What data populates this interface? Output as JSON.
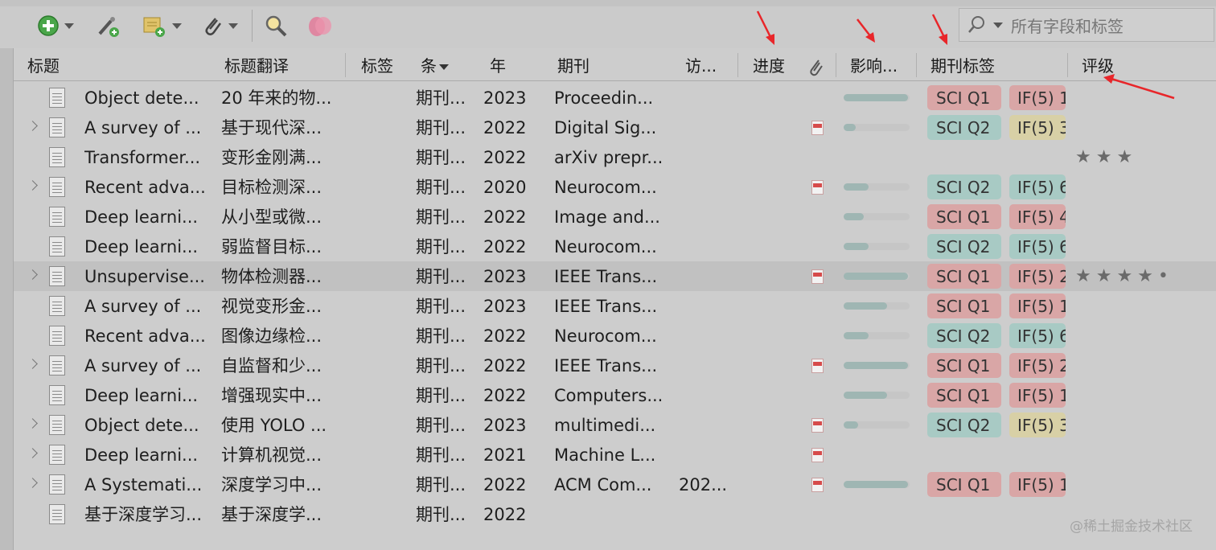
{
  "toolbar": {
    "search_placeholder": "所有字段和标签"
  },
  "columns": {
    "title": "标题",
    "title_translation": "标题翻译",
    "tags": "标签",
    "item_type": "条",
    "year": "年",
    "journal": "期刊",
    "access": "访...",
    "progress": "进度",
    "impact": "影响...",
    "journal_tags": "期刊标签",
    "rating": "评级"
  },
  "rows": [
    {
      "title": "Object dete...",
      "trans": "20 年来的物...",
      "type": "期刊...",
      "year": "2023",
      "journal": "Proceedin...",
      "access": "",
      "expand": false,
      "pdf": false,
      "impact": 0.98,
      "sci": "SCI Q1",
      "if": "IF(5) 1",
      "rating": ""
    },
    {
      "title": "A survey of ...",
      "trans": "基于现代深...",
      "type": "期刊...",
      "year": "2022",
      "journal": "Digital Sig...",
      "access": "",
      "expand": true,
      "pdf": true,
      "impact": 0.18,
      "sci": "SCI Q2",
      "if": "IF(5) 3",
      "rating": ""
    },
    {
      "title": "Transformer...",
      "trans": "变形金刚满...",
      "type": "期刊...",
      "year": "2022",
      "journal": "arXiv prepr...",
      "access": "",
      "expand": false,
      "pdf": false,
      "impact": null,
      "sci": "",
      "if": "",
      "rating": "★★★"
    },
    {
      "title": "Recent adva...",
      "trans": "目标检测深...",
      "type": "期刊...",
      "year": "2020",
      "journal": "Neurocom...",
      "access": "",
      "expand": true,
      "pdf": true,
      "impact": 0.38,
      "sci": "SCI Q2",
      "if": "IF(5) 6",
      "rating": ""
    },
    {
      "title": "Deep learni...",
      "trans": "从小型或微...",
      "type": "期刊...",
      "year": "2022",
      "journal": "Image and...",
      "access": "",
      "expand": false,
      "pdf": false,
      "impact": 0.3,
      "sci": "SCI Q1",
      "if": "IF(5) 4",
      "rating": ""
    },
    {
      "title": "Deep learni...",
      "trans": "弱监督目标...",
      "type": "期刊...",
      "year": "2022",
      "journal": "Neurocom...",
      "access": "",
      "expand": false,
      "pdf": false,
      "impact": 0.38,
      "sci": "SCI Q2",
      "if": "IF(5) 6",
      "rating": ""
    },
    {
      "title": "Unsupervise...",
      "trans": "物体检测器...",
      "type": "期刊...",
      "year": "2023",
      "journal": "IEEE Trans...",
      "access": "",
      "expand": true,
      "pdf": true,
      "impact": 0.98,
      "sci": "SCI Q1",
      "if": "IF(5) 2",
      "rating": "★★★★•"
    },
    {
      "title": "A survey of ...",
      "trans": "视觉变形金...",
      "type": "期刊...",
      "year": "2023",
      "journal": "IEEE Trans...",
      "access": "",
      "expand": false,
      "pdf": false,
      "impact": 0.66,
      "sci": "SCI Q1",
      "if": "IF(5) 1",
      "rating": ""
    },
    {
      "title": "Recent adva...",
      "trans": "图像边缘检...",
      "type": "期刊...",
      "year": "2022",
      "journal": "Neurocom...",
      "access": "",
      "expand": false,
      "pdf": false,
      "impact": 0.38,
      "sci": "SCI Q2",
      "if": "IF(5) 6",
      "rating": ""
    },
    {
      "title": "A survey of ...",
      "trans": "自监督和少...",
      "type": "期刊...",
      "year": "2022",
      "journal": "IEEE Trans...",
      "access": "",
      "expand": true,
      "pdf": true,
      "impact": 0.98,
      "sci": "SCI Q1",
      "if": "IF(5) 2",
      "rating": ""
    },
    {
      "title": "Deep learni...",
      "trans": "增强现实中...",
      "type": "期刊...",
      "year": "2022",
      "journal": "Computers...",
      "access": "",
      "expand": false,
      "pdf": false,
      "impact": 0.66,
      "sci": "SCI Q1",
      "if": "IF(5) 1",
      "rating": ""
    },
    {
      "title": "Object dete...",
      "trans": "使用 YOLO ...",
      "type": "期刊...",
      "year": "2023",
      "journal": "multimedi...",
      "access": "",
      "expand": true,
      "pdf": true,
      "impact": 0.22,
      "sci": "SCI Q2",
      "if": "IF(5) 3",
      "rating": ""
    },
    {
      "title": "Deep learni...",
      "trans": "计算机视觉...",
      "type": "期刊...",
      "year": "2021",
      "journal": "Machine L...",
      "access": "",
      "expand": true,
      "pdf": true,
      "impact": null,
      "sci": "",
      "if": "",
      "rating": ""
    },
    {
      "title": "A Systemati...",
      "trans": "深度学习中...",
      "type": "期刊...",
      "year": "2022",
      "journal": "ACM Com...",
      "access": "202...",
      "expand": true,
      "pdf": true,
      "impact": 0.98,
      "sci": "SCI Q1",
      "if": "IF(5) 1",
      "rating": ""
    },
    {
      "title": "基于深度学习...",
      "trans": "基于深度学...",
      "type": "期刊...",
      "year": "2022",
      "journal": "",
      "access": "",
      "expand": false,
      "pdf": false,
      "impact": null,
      "sci": "",
      "if": "",
      "rating": ""
    }
  ],
  "watermark": "@稀土掘金技术社区",
  "colors": {
    "sci_q1": "#d9a6a6",
    "sci_q2": "#a8cac4",
    "if_yellow": "#d8d0a6",
    "arrow": "#e8262a"
  }
}
